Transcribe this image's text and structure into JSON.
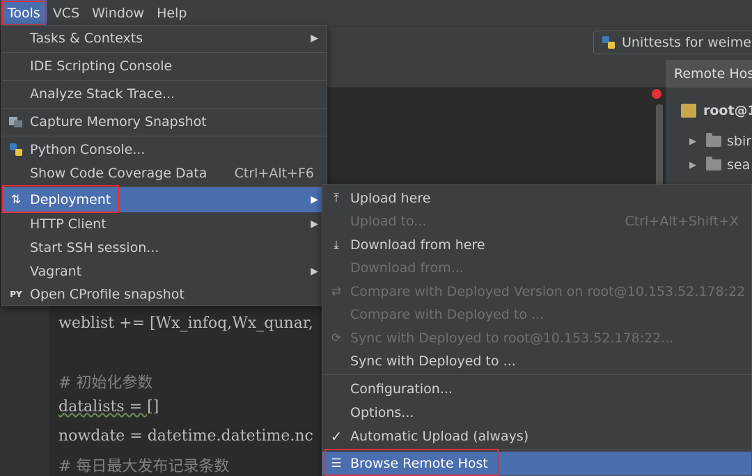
{
  "menubar": {
    "items": [
      "Tools",
      "VCS",
      "Window",
      "Help"
    ]
  },
  "toolbar": {
    "run_config": "Unittests for weimer"
  },
  "remote_panel": {
    "tab_label": "Remote Hos",
    "root_label": "root@1",
    "folders": [
      "sbir",
      "sea"
    ]
  },
  "editor": {
    "lines": [
      "weblist += [Wx_infoq,Wx_qunar,",
      "# 初始化参数",
      "datalists = []",
      "nowdate = datetime.datetime.nc",
      "# 每日最大发布记录条数"
    ]
  },
  "tools_menu": {
    "items": [
      {
        "label": "Tasks & Contexts",
        "shortcut": "",
        "submenu": true
      },
      {
        "label": "IDE Scripting Console",
        "shortcut": "",
        "submenu": false
      },
      {
        "label": "Analyze Stack Trace...",
        "shortcut": "",
        "submenu": false
      },
      {
        "label": "Capture Memory Snapshot",
        "shortcut": "",
        "submenu": false
      },
      {
        "label": "Python Console...",
        "shortcut": "",
        "submenu": false
      },
      {
        "label": "Show Code Coverage Data",
        "shortcut": "Ctrl+Alt+F6",
        "submenu": false
      },
      {
        "label": "Deployment",
        "shortcut": "",
        "submenu": true
      },
      {
        "label": "HTTP Client",
        "shortcut": "",
        "submenu": true
      },
      {
        "label": "Start SSH session...",
        "shortcut": "",
        "submenu": false
      },
      {
        "label": "Vagrant",
        "shortcut": "",
        "submenu": true
      },
      {
        "label": "Open CProfile snapshot",
        "shortcut": "",
        "submenu": false
      }
    ],
    "selected": "Deployment"
  },
  "deployment_menu": {
    "items": [
      {
        "label": "Upload here",
        "shortcut": "",
        "enabled": true
      },
      {
        "label": "Upload to...",
        "shortcut": "Ctrl+Alt+Shift+X",
        "enabled": false
      },
      {
        "label": "Download from here",
        "shortcut": "",
        "enabled": true
      },
      {
        "label": "Download from...",
        "shortcut": "",
        "enabled": false
      },
      {
        "label": "Compare with Deployed Version on root@10.153.52.178:22",
        "shortcut": "",
        "enabled": false
      },
      {
        "label": "Compare with Deployed to ...",
        "shortcut": "",
        "enabled": false
      },
      {
        "label": "Sync with Deployed to root@10.153.52.178:22...",
        "shortcut": "",
        "enabled": false
      },
      {
        "label": "Sync with Deployed to ...",
        "shortcut": "",
        "enabled": true
      },
      {
        "label": "Configuration...",
        "shortcut": "",
        "enabled": true
      },
      {
        "label": "Options...",
        "shortcut": "",
        "enabled": true
      },
      {
        "label": "Automatic Upload (always)",
        "shortcut": "",
        "enabled": true,
        "checked": true
      },
      {
        "label": "Browse Remote Host",
        "shortcut": "",
        "enabled": true
      }
    ],
    "selected": "Browse Remote Host"
  },
  "colors": {
    "selection": "#4b6eaf",
    "highlight_box": "#e0303a"
  }
}
